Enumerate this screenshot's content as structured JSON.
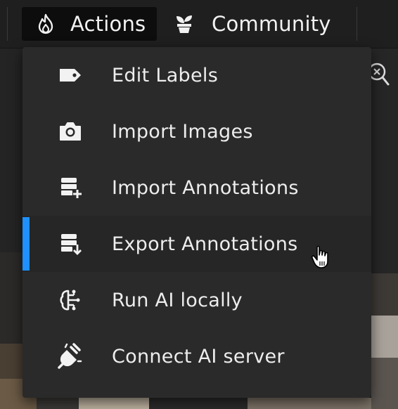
{
  "topbar": {
    "actions": {
      "label": "Actions",
      "icon": "flame-icon",
      "active": true
    },
    "community": {
      "label": "Community",
      "icon": "plant-icon"
    }
  },
  "menu": {
    "items": [
      {
        "label": "Edit Labels",
        "icon": "tag-icon"
      },
      {
        "label": "Import Images",
        "icon": "camera-icon"
      },
      {
        "label": "Import Annotations",
        "icon": "list-plus-icon"
      },
      {
        "label": "Export Annotations",
        "icon": "list-download-icon",
        "selected": true
      },
      {
        "label": "Run AI locally",
        "icon": "brain-circuit-icon"
      },
      {
        "label": "Connect AI server",
        "icon": "plug-icon"
      }
    ]
  },
  "colors": {
    "accent": "#1e90ff",
    "menu_bg": "#2a2a2a",
    "topbar_bg": "#1f1f1f",
    "active_tab_bg": "#0d0d0d"
  }
}
